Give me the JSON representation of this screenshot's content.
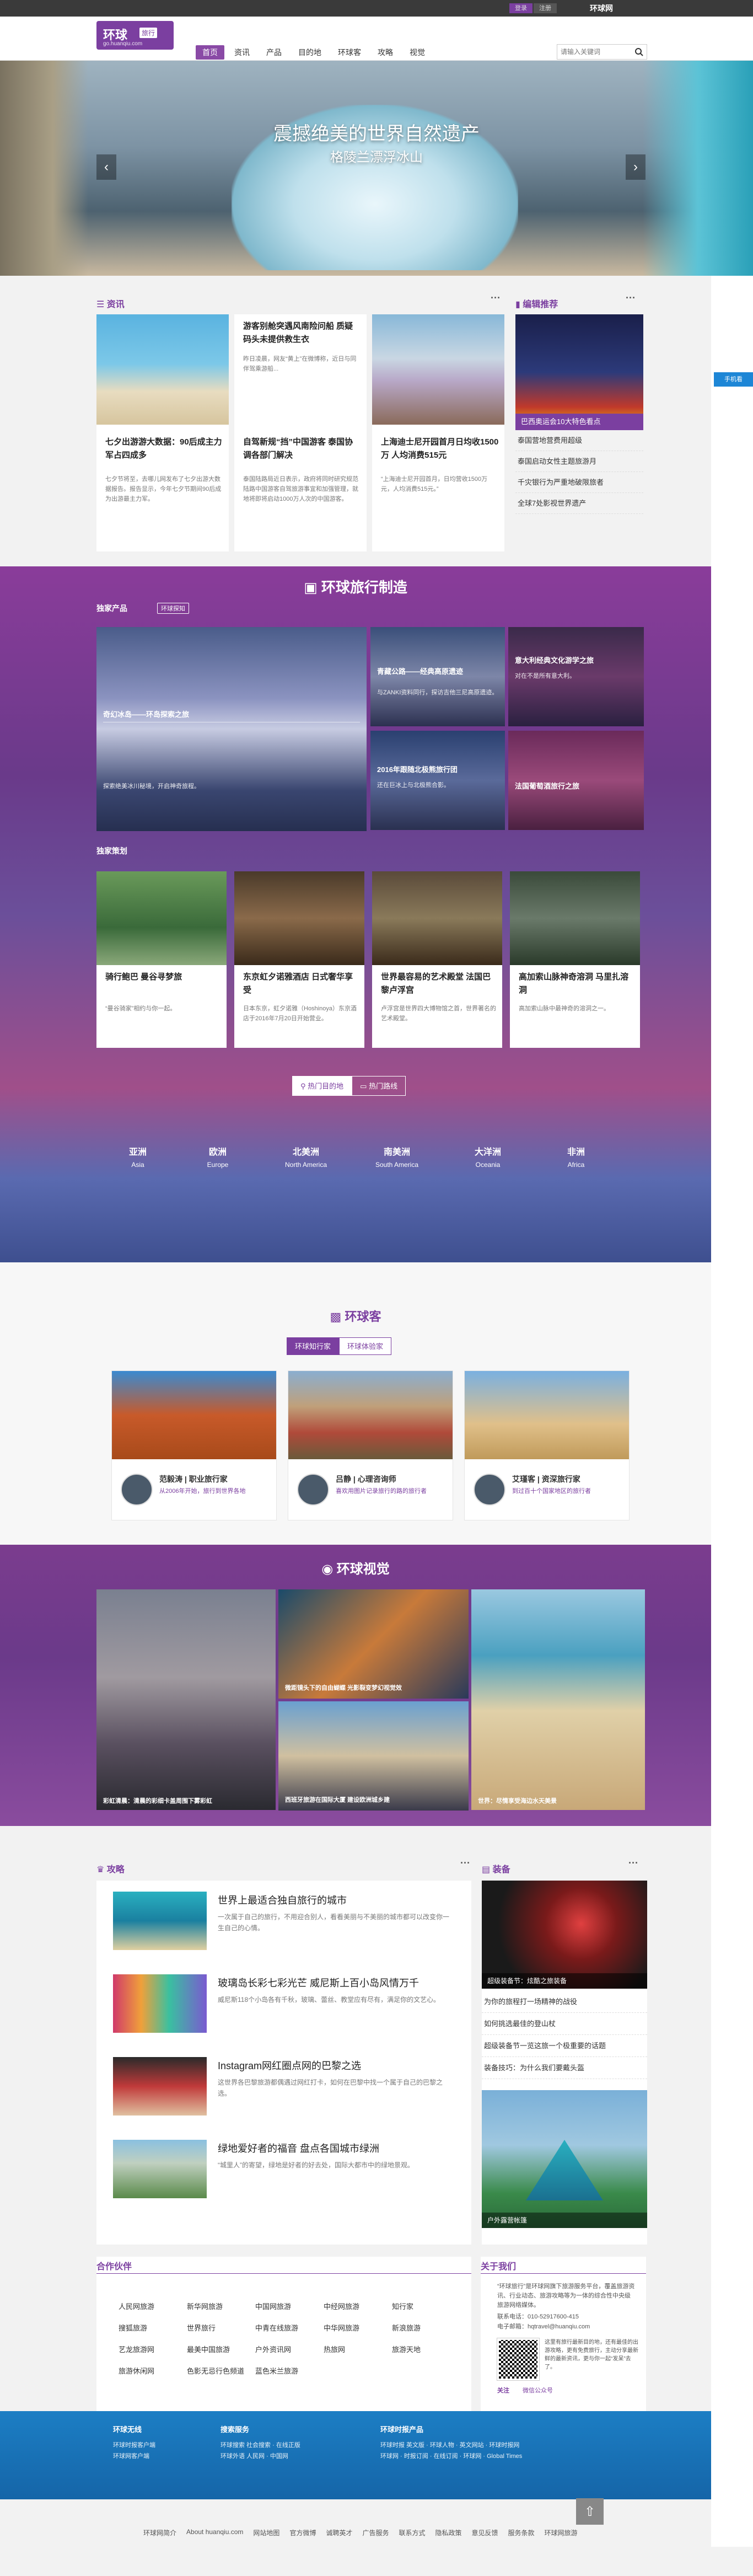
{
  "topbar": {
    "left_btn": "登录",
    "right_btn": "注册",
    "logo_text": "环球网"
  },
  "header": {
    "logo_main": "环球",
    "logo_tag": "旅行",
    "logo_url": "go.huanqiu.com"
  },
  "nav": [
    "首页",
    "资讯",
    "产品",
    "目的地",
    "环球客",
    "攻略",
    "视觉"
  ],
  "search": {
    "placeholder": "请输入关键词"
  },
  "banner": {
    "title": "震撼绝美的世界自然遗产",
    "subtitle": "格陵兰漂浮冰山"
  },
  "news": {
    "title": "资讯",
    "cards": [
      {
        "title": "七夕出游游大数据：90后成主力军占四成多",
        "desc": "七夕节将至，去哪儿网发布了七夕出游大数据报告。报告显示，今年七夕节期间90后成为出游最主力军。"
      },
      {
        "title": "游客别舱突遇风南险问船 质疑码头未提供救生衣",
        "desc": "昨日凌晨，网友“黄上”在微博称，近日与同伴驾乘游船...",
        "img_title": "自驾新规“挡”中国游客 泰国协调各部门解决",
        "img_desc": "泰国陆路局近日表示，政府将同时研究规范陆路中国游客自驾旅游事宜和加强管理，就地将即将启动1000万人次的中国游客。"
      },
      {
        "title": "上海迪士尼开园首月日均收1500万 人均消费515元",
        "desc": "“上海迪士尼开园首月，日均营收1500万元，人均消费515元。”"
      }
    ]
  },
  "editor": {
    "title": "编辑推荐",
    "highlight": "巴西奥运会10大特色看点",
    "items": [
      "泰国营地营费用超级",
      "泰国启动女性主题旅游月",
      "千灾银行为严重地破限旅者",
      "全球7处影视世界遗产"
    ]
  },
  "production": {
    "title": "环球旅行制造",
    "sub1": "独家产品",
    "pill": "环球探知",
    "big_cap": "奇幻冰岛——环岛探索之旅",
    "big_desc": "探索绝美冰川秘境，开启神奇旅程。",
    "small": [
      {
        "cap": "青藏公路——经典高原遗迹",
        "desc": "与ZANKI资料同行，探访吉他三尼高原遗迹。"
      },
      {
        "cap": "意大利经典文化游学之旅",
        "desc": "对在不是所有意大利。"
      },
      {
        "cap": "2016年跟随北极熊旅行团",
        "desc": "还在巨冰上与北极熊合影。"
      },
      {
        "cap": "法国葡萄酒旅行之旅",
        "desc": "法国葡萄酒旅行之旅。"
      }
    ],
    "sub2": "独家策划",
    "plans": [
      {
        "title": "骑行鲍巴 曼谷寻梦旅",
        "desc": "“曼谷骑家”相约与你一起。"
      },
      {
        "title": "东京虹夕诺雅酒店 日式奢华享受",
        "desc": "日本东京，虹夕诺雅（Hoshinoya）东京酒店于2016年7月20日开始营业。"
      },
      {
        "title": "世界最容易的艺术殿堂 法国巴黎卢浮宫",
        "desc": "卢浮宫是世界四大博物馆之首，世界著名的艺术殿堂。"
      },
      {
        "title": "高加索山脉神奇溶洞 马里扎溶洞",
        "desc": "高加索山脉中最神奇的溶洞之一。"
      }
    ],
    "tabs": [
      "热门目的地",
      "热门路线"
    ],
    "regions": [
      {
        "zh": "亚洲",
        "en": "Asia"
      },
      {
        "zh": "欧洲",
        "en": "Europe"
      },
      {
        "zh": "北美洲",
        "en": "North America"
      },
      {
        "zh": "南美洲",
        "en": "South America"
      },
      {
        "zh": "大洋洲",
        "en": "Oceania"
      },
      {
        "zh": "非洲",
        "en": "Africa"
      }
    ]
  },
  "experts": {
    "title": "环球客",
    "tabs": [
      "环球知行家",
      "环球体验家"
    ],
    "cards": [
      {
        "name": "范毅涛 | 职业旅行家",
        "desc": "从2006年开始，旅行到世界各地"
      },
      {
        "name": "吕静 | 心理咨询师",
        "desc": "喜欢用图片记录旅行的路的旅行者"
      },
      {
        "name": "艾瑾客 | 资深旅行家",
        "desc": "到过百十个国家地区的旅行者"
      }
    ]
  },
  "visual": {
    "title": "环球视觉",
    "caps": [
      "彩虹清晨：清晨的彩细卡盖周围下雾彩虹",
      "微距镜头下的自由蝴蝶 光影裂变梦幻视觉效",
      "西班牙旅游在国际大厦 建设欧洲城乡建",
      "世界：尽情享受海边水天美景"
    ]
  },
  "guide": {
    "title": "攻略",
    "items": [
      {
        "title": "世界上最适合独自旅行的城市",
        "desc": "一次属于自己的旅行，不用迎合别人，看看美丽与不美丽的城市都可以改变你一生自己的心情。"
      },
      {
        "title": "玻璃岛长彩七彩光芒 威尼斯上百小岛风情万千",
        "desc": "威尼斯118个小岛各有千秋，玻璃、蕾丝、教堂应有尽有，满足你的文艺心。"
      },
      {
        "title": "Instagram网红圈点网的巴黎之选",
        "desc": "这世界各巴黎旅游都偶遇过网红打卡，如何在巴黎中找一个属于自己的巴黎之选。"
      },
      {
        "title": "绿地爱好者的福音 盘点各国城市绿洲",
        "desc": "“城里人”的寄望，绿地是好者的好去处，国际大都市中的绿地景观。"
      }
    ]
  },
  "equipment": {
    "title": "装备",
    "cap1": "超级装备节：炫酷之旅装备",
    "items": [
      "为你的旅程打一场精神的战役",
      "如何挑选最佳的登山杖",
      "超级装备节一览这旅一个极重要的话题",
      "装备技巧：为什么我们要戴头盔"
    ],
    "cap2": "户外露营帐篷"
  },
  "partners": {
    "title": "合作伙伴",
    "items": [
      "人民网旅游",
      "新华网旅游",
      "中国网旅游",
      "中经网旅游",
      "知行家",
      "搜狐旅游",
      "世界旅行",
      "中青在线旅游",
      "中华网旅游",
      "新浪旅游",
      "艺龙旅游网",
      "最美中国旅游",
      "户外资讯网",
      "热旅网",
      "旅游天地",
      "旅游休闲网",
      "色影无忌行色频道",
      "蓝色米兰旅游",
      "",
      ""
    ]
  },
  "about": {
    "title": "关于我们",
    "text": "“环球旅行”是环球网旗下旅游服务平台，覆盖旅游资讯、行业动态、旅游攻略等为一体的综合性中央级旅游网络媒体。",
    "tel": "联系电话：010-52917600-415",
    "email": "电子邮箱：hqtravel@huanqiu.com",
    "qr_text": "这里有旅行最新目的地，还有最佳的出游攻略，更有免费旅行，主动分享最新鲜的最新资讯，更与你一起“发呆”去了。",
    "qr_label": "微信公众号",
    "follow": "关注"
  },
  "footer": {
    "cols": [
      {
        "h": "环球无线",
        "items": [
          "环球时报客户端",
          "环球网客户端"
        ]
      },
      {
        "h": "搜索服务",
        "items": [
          "环球搜索 社会搜索 · 在线正版",
          "环球外语 人民网 · 中国网"
        ]
      },
      {
        "h": "环球时报产品",
        "items": [
          "环球时报 英文版 · 环球人物 · 英文网站 · 环球时报网",
          "环球网 · 时报订阅 · 在线订阅 · 环球网 · Global Times"
        ]
      }
    ],
    "links": [
      "环球网简介",
      "About huanqiu.com",
      "网站地图",
      "官方微博",
      "诚聘英才",
      "广告服务",
      "联系方式",
      "隐私政策",
      "意见反馈",
      "服务条款",
      "环球网旅游"
    ]
  },
  "side": {
    "badge": "手机看"
  }
}
